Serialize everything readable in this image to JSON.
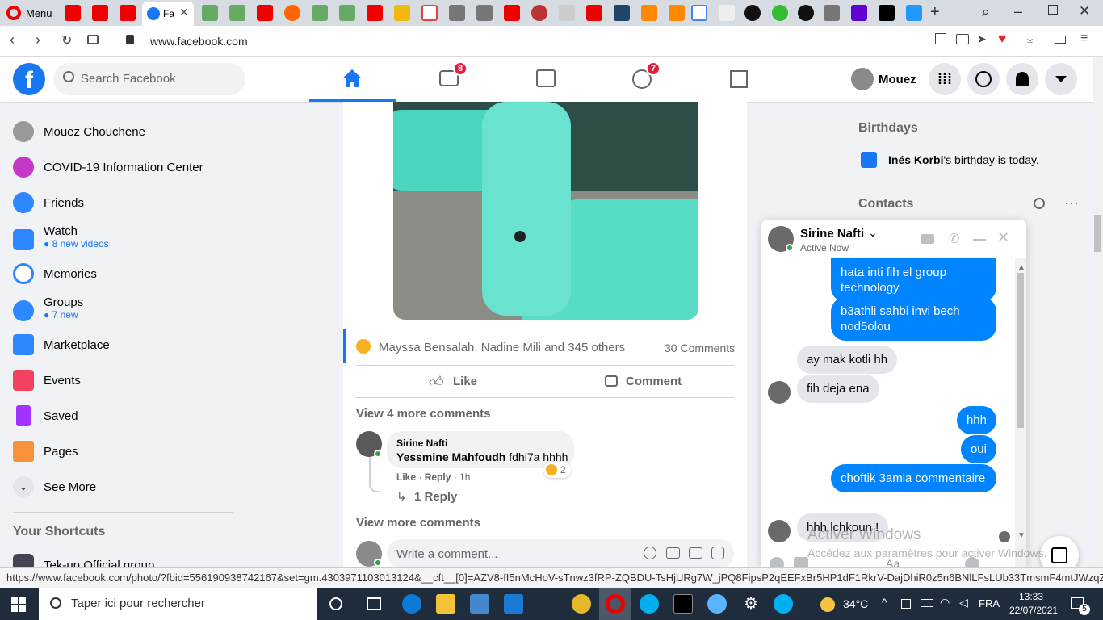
{
  "browser": {
    "menu_label": "Menu",
    "active_tab_label": "Fa",
    "url": "www.facebook.com",
    "status_url": "https://www.facebook.com/photo/?fbid=556190938742167&set=gm.4303971103013124&__cft__[0]=AZV8-fI5nMcHoV-sTnwz3fRP-ZQBDU-TsHjURg7W_jPQ8FipsP2qEEFxBr5HP1dF1RkrV-DajDhiR0z5n6BNlLFsLUb33TmsmF4mtJWzqZsG..."
  },
  "header": {
    "search_placeholder": "Search Facebook",
    "watch_badge": "8",
    "groups_badge": "7",
    "user_name": "Mouez"
  },
  "sidebar": {
    "items": [
      {
        "label": "Mouez Chouchene"
      },
      {
        "label": "COVID-19 Information Center"
      },
      {
        "label": "Friends"
      },
      {
        "label": "Watch",
        "sub": "8 new videos"
      },
      {
        "label": "Memories"
      },
      {
        "label": "Groups",
        "sub": "7 new"
      },
      {
        "label": "Marketplace"
      },
      {
        "label": "Events"
      },
      {
        "label": "Saved"
      },
      {
        "label": "Pages"
      },
      {
        "label": "See More"
      }
    ],
    "shortcuts_title": "Your Shortcuts",
    "shortcut_partial": "Tek-up Official group"
  },
  "post": {
    "reactors": "Mayssa Bensalah, Nadine Mili and 345 others",
    "comments_count": "30 Comments",
    "like_label": "Like",
    "comment_label": "Comment",
    "view_more_top": "View 4 more comments",
    "comment": {
      "author": "Sirine Nafti",
      "mention": "Yessmine Mahfoudh",
      "text": "fdhi7a hhhh",
      "reaction_count": "2",
      "like": "Like",
      "reply": "Reply",
      "time": "1h",
      "replies": "1 Reply"
    },
    "view_more_bottom": "View more comments",
    "write_placeholder": "Write a comment..."
  },
  "right": {
    "birthdays_title": "Birthdays",
    "birthday_name": "Inés Korbi",
    "birthday_text": "'s birthday is today.",
    "contacts_title": "Contacts"
  },
  "chat": {
    "name": "Sirine Nafti",
    "status": "Active Now",
    "messages": [
      {
        "from": "me",
        "text": "hata inti fih el group technology"
      },
      {
        "from": "me",
        "text": "b3athli sahbi invi bech nod5olou"
      },
      {
        "from": "them",
        "text": "ay mak kotli hh"
      },
      {
        "from": "them",
        "text": "fih deja ena"
      },
      {
        "from": "me",
        "text": "hhh"
      },
      {
        "from": "me",
        "text": "oui"
      },
      {
        "from": "me",
        "text": "choftik 3amla commentaire"
      },
      {
        "from": "them",
        "text": "hhh lchkoun !"
      }
    ],
    "input_partial": "Aa"
  },
  "watermark": {
    "line1": "Activer Windows",
    "line2": "Accédez aux paramètres pour activer Windows."
  },
  "taskbar": {
    "search_placeholder": "Taper ici pour rechercher",
    "temperature": "34°C",
    "language": "FRA",
    "time": "13:33",
    "date": "22/07/2021",
    "notif_count": "5"
  },
  "colors": {
    "fb_blue": "#1877f2",
    "messenger_blue": "#0084ff",
    "badge_red": "#e41e3f"
  }
}
